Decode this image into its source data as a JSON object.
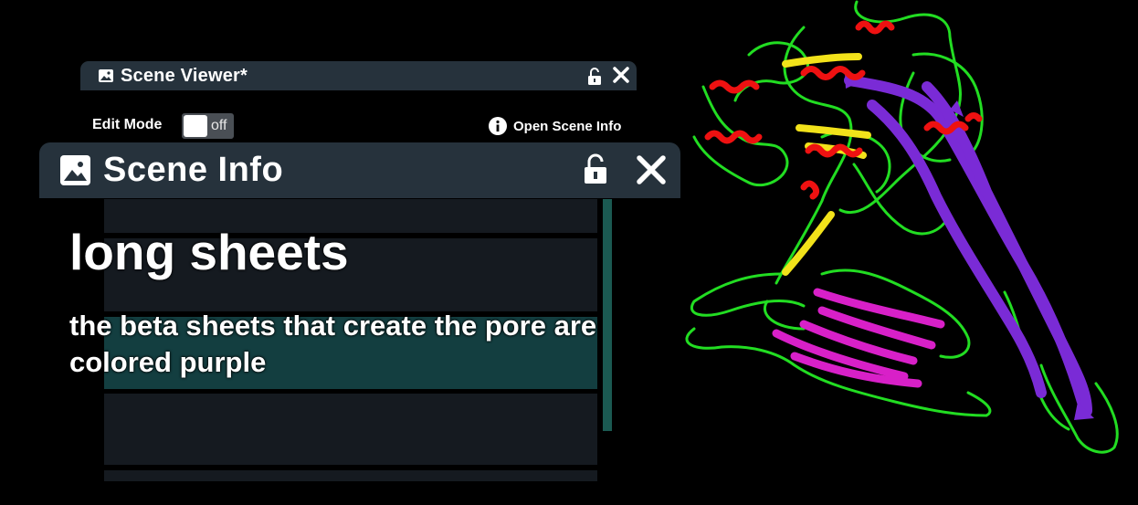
{
  "scene_viewer": {
    "title": "Scene Viewer*",
    "edit_mode_label": "Edit Mode",
    "edit_mode_state": "off",
    "open_scene_info_label": "Open Scene Info"
  },
  "scene_info": {
    "title": "Scene Info",
    "heading": "long sheets",
    "body": "the beta sheets that create the pore are colored purple"
  },
  "viewport": {
    "structure_colors": {
      "coil": "#22dd22",
      "helix": "#ee1111",
      "sheet_pore": "#7a2bd6",
      "sheet_magenta": "#d820c8",
      "sheet_yellow": "#f2e21a"
    }
  },
  "theme": {
    "panel_bg": "#26323c",
    "list_selected": "#133e40",
    "list_bg": "#151a20",
    "scrollbar": "#1b5a52"
  }
}
